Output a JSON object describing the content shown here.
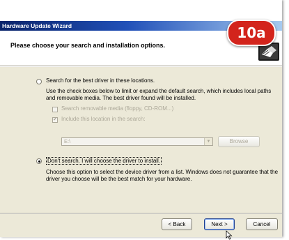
{
  "window": {
    "title": "Hardware Update Wizard"
  },
  "header": {
    "title": "Please choose your search and installation options."
  },
  "badge": {
    "label": "10a"
  },
  "option_search": {
    "label": "Search for the best driver in these locations.",
    "selected": false,
    "description": "Use the check boxes below to limit or expand the default search, which includes local paths and removable media. The best driver found will be installed.",
    "check_removable": {
      "label": "Search removable media (floppy, CD-ROM...)",
      "checked": false
    },
    "check_location": {
      "label": "Include this location in the search:",
      "checked": true
    },
    "location_value": "E:\\",
    "browse_label": "Browse"
  },
  "option_manual": {
    "label": "Don't search. I will choose the driver to install.",
    "selected": true,
    "description": "Choose this option to select the device driver from a list. Windows does not guarantee that the driver you choose will be the best match for your hardware."
  },
  "buttons": {
    "back": "< Back",
    "next": "Next >",
    "cancel": "Cancel"
  },
  "colors": {
    "titlebar_start": "#0a246a",
    "titlebar_end": "#a6caf0",
    "dialog_bg": "#ece9d8",
    "badge": "#d3241c"
  },
  "icons": {
    "wizard": "hardware-wizard-icon",
    "cursor": "mouse-pointer-icon"
  }
}
